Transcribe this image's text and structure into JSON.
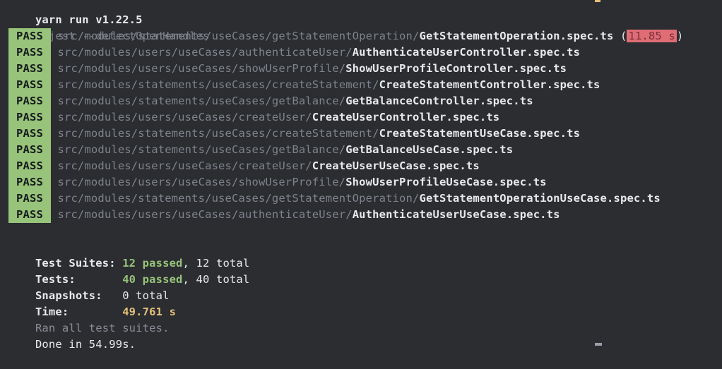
{
  "header": {
    "yarn_line": "yarn run v1.22.5",
    "command_prompt": "$ ",
    "command": "jest --detectOpenHandles"
  },
  "results": [
    {
      "status": "PASS",
      "dir": "src/modules/statements/useCases/getStatementOperation/",
      "file": "GetStatementOperation.spec.ts",
      "duration": "11.85 s"
    },
    {
      "status": "PASS",
      "dir": "src/modules/users/useCases/authenticateUser/",
      "file": "AuthenticateUserController.spec.ts"
    },
    {
      "status": "PASS",
      "dir": "src/modules/users/useCases/showUserProfile/",
      "file": "ShowUserProfileController.spec.ts"
    },
    {
      "status": "PASS",
      "dir": "src/modules/statements/useCases/createStatement/",
      "file": "CreateStatementController.spec.ts"
    },
    {
      "status": "PASS",
      "dir": "src/modules/statements/useCases/getBalance/",
      "file": "GetBalanceController.spec.ts"
    },
    {
      "status": "PASS",
      "dir": "src/modules/users/useCases/createUser/",
      "file": "CreateUserController.spec.ts"
    },
    {
      "status": "PASS",
      "dir": "src/modules/statements/useCases/createStatement/",
      "file": "CreateStatementUseCase.spec.ts"
    },
    {
      "status": "PASS",
      "dir": "src/modules/statements/useCases/getBalance/",
      "file": "GetBalanceUseCase.spec.ts"
    },
    {
      "status": "PASS",
      "dir": "src/modules/users/useCases/createUser/",
      "file": "CreateUserUseCase.spec.ts"
    },
    {
      "status": "PASS",
      "dir": "src/modules/users/useCases/showUserProfile/",
      "file": "ShowUserProfileUseCase.spec.ts"
    },
    {
      "status": "PASS",
      "dir": "src/modules/statements/useCases/getStatementOperation/",
      "file": "GetStatementOperationUseCase.spec.ts"
    },
    {
      "status": "PASS",
      "dir": "src/modules/users/useCases/authenticateUser/",
      "file": "AuthenticateUserUseCase.spec.ts"
    }
  ],
  "summary": {
    "suites_label": "Test Suites: ",
    "suites_passed": "12 passed",
    "suites_total": ", 12 total",
    "tests_label": "Tests:       ",
    "tests_passed": "40 passed",
    "tests_total": ", 40 total",
    "snapshots_label": "Snapshots:   ",
    "snapshots_value": "0 total",
    "time_label": "Time:        ",
    "time_value": "49.761 s",
    "ran_all": "Ran all test suites.",
    "done": "Done in 54.99s."
  },
  "colors": {
    "background": "#2b2d31",
    "pass_badge": "#97c47a",
    "slow_highlight": "#e06c75",
    "passed_green": "#98c379",
    "time_yellow": "#e5c07b"
  }
}
